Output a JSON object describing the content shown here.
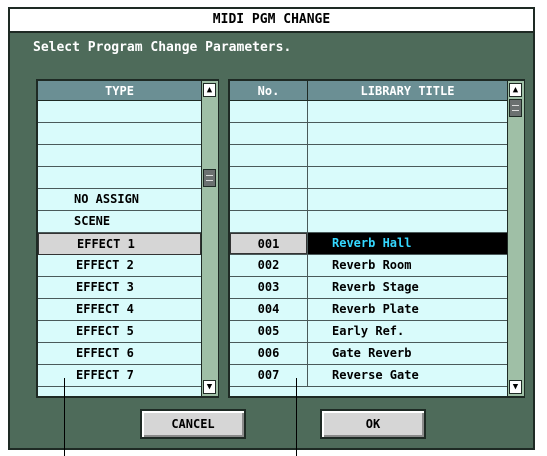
{
  "window": {
    "title": "MIDI PGM CHANGE",
    "subtitle": "Select Program Change Parameters."
  },
  "type_list": {
    "header": "TYPE",
    "items": [
      "",
      "",
      "",
      "",
      "NO ASSIGN",
      "SCENE",
      "EFFECT 1",
      "EFFECT 2",
      "EFFECT 3",
      "EFFECT 4",
      "EFFECT 5",
      "EFFECT 6",
      "EFFECT 7"
    ],
    "selected": "EFFECT 1"
  },
  "library_list": {
    "header_no": "No.",
    "header_title": "LIBRARY TITLE",
    "rows": [
      {
        "no": "",
        "title": ""
      },
      {
        "no": "",
        "title": ""
      },
      {
        "no": "",
        "title": ""
      },
      {
        "no": "",
        "title": ""
      },
      {
        "no": "",
        "title": ""
      },
      {
        "no": "",
        "title": ""
      },
      {
        "no": "001",
        "title": "Reverb Hall"
      },
      {
        "no": "002",
        "title": "Reverb Room"
      },
      {
        "no": "003",
        "title": "Reverb Stage"
      },
      {
        "no": "004",
        "title": "Reverb Plate"
      },
      {
        "no": "005",
        "title": "Early Ref."
      },
      {
        "no": "006",
        "title": "Gate Reverb"
      },
      {
        "no": "007",
        "title": "Reverse Gate"
      }
    ],
    "selected_no": "001"
  },
  "buttons": {
    "cancel": "CANCEL",
    "ok": "OK"
  },
  "icons": {
    "scroll_up": "scroll-up-arrow-icon",
    "scroll_down": "scroll-down-arrow-icon"
  },
  "colors": {
    "panel": "#4e6b5a",
    "list_bg": "#d9fbfb",
    "header_bg": "#6b8f94",
    "selected_title_bg": "#000000",
    "selected_title_fg": "#35d8ff"
  }
}
